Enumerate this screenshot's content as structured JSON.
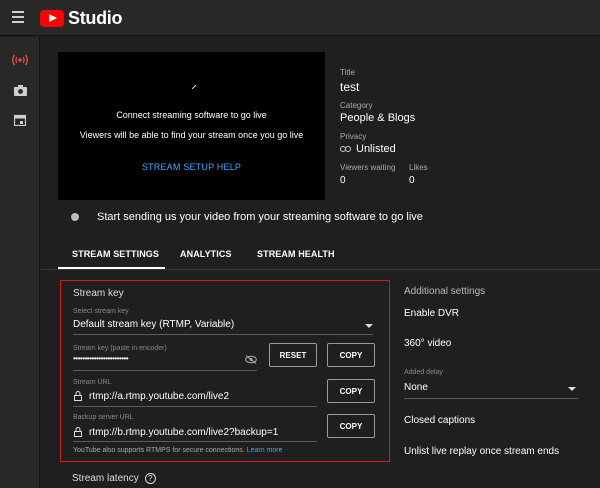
{
  "app": {
    "logo_text": "Studio"
  },
  "preview": {
    "connect_text": "Connect streaming software to go live",
    "viewers_text": "Viewers will be able to find your stream once you go live",
    "setup_help": "STREAM SETUP HELP"
  },
  "details": {
    "title_label": "Title",
    "title_value": "test",
    "category_label": "Category",
    "category_value": "People & Blogs",
    "privacy_label": "Privacy",
    "privacy_value": "Unlisted",
    "viewers_label": "Viewers waiting",
    "viewers_value": "0",
    "likes_label": "Likes",
    "likes_value": "0"
  },
  "status": {
    "text": "Start sending us your video from your streaming software to go live"
  },
  "tabs": [
    {
      "label": "STREAM SETTINGS",
      "active": true
    },
    {
      "label": "ANALYTICS",
      "active": false
    },
    {
      "label": "STREAM HEALTH",
      "active": false
    }
  ],
  "stream_key": {
    "section_title": "Stream key",
    "select_label": "Select stream key",
    "select_value": "Default stream key (RTMP, Variable)",
    "key_label": "Stream key (paste in encoder)",
    "key_value": "••••••••••••••••••••••••",
    "reset_label": "RESET",
    "copy_label": "COPY",
    "url_label": "Stream URL",
    "url_value": "rtmp://a.rtmp.youtube.com/live2",
    "backup_label": "Backup server URL",
    "backup_value": "rtmp://b.rtmp.youtube.com/live2?backup=1",
    "note_text": "YouTube also supports RTMPS for secure connections.",
    "note_link": "Learn more"
  },
  "latency": {
    "title": "Stream latency",
    "help": "?"
  },
  "additional": {
    "title": "Additional settings",
    "dvr": "Enable DVR",
    "three_sixty": "360° video",
    "delay_label": "Added delay",
    "delay_value": "None",
    "captions": "Closed captions",
    "unlist": "Unlist live replay once stream ends"
  },
  "colors": {
    "accent": "#3ea6ff",
    "highlight": "#d31a1a",
    "brand": "#ff0000",
    "live_icon": "#ff4e45"
  }
}
